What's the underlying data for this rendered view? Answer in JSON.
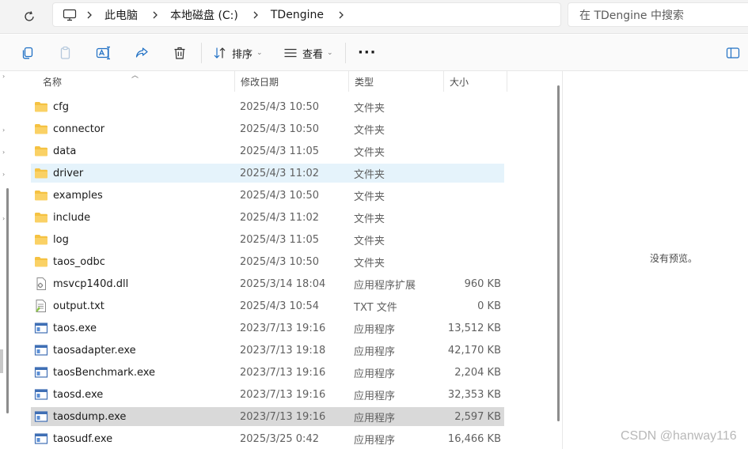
{
  "address_bar": {
    "breadcrumbs": [
      "此电脑",
      "本地磁盘 (C:)",
      "TDengine"
    ],
    "search_placeholder": "在 TDengine 中搜索"
  },
  "toolbar": {
    "sort_label": "排序",
    "view_label": "查看"
  },
  "columns": {
    "name": "名称",
    "date": "修改日期",
    "type": "类型",
    "size": "大小"
  },
  "files": [
    {
      "name": "cfg",
      "date": "2025/4/3 10:50",
      "type": "文件夹",
      "size": "",
      "icon": "folder-icon"
    },
    {
      "name": "connector",
      "date": "2025/4/3 10:50",
      "type": "文件夹",
      "size": "",
      "icon": "folder-icon"
    },
    {
      "name": "data",
      "date": "2025/4/3 11:05",
      "type": "文件夹",
      "size": "",
      "icon": "folder-icon"
    },
    {
      "name": "driver",
      "date": "2025/4/3 11:02",
      "type": "文件夹",
      "size": "",
      "icon": "folder-icon"
    },
    {
      "name": "examples",
      "date": "2025/4/3 10:50",
      "type": "文件夹",
      "size": "",
      "icon": "folder-icon"
    },
    {
      "name": "include",
      "date": "2025/4/3 11:02",
      "type": "文件夹",
      "size": "",
      "icon": "folder-icon"
    },
    {
      "name": "log",
      "date": "2025/4/3 11:05",
      "type": "文件夹",
      "size": "",
      "icon": "folder-icon"
    },
    {
      "name": "taos_odbc",
      "date": "2025/4/3 10:50",
      "type": "文件夹",
      "size": "",
      "icon": "folder-icon"
    },
    {
      "name": "msvcp140d.dll",
      "date": "2025/3/14 18:04",
      "type": "应用程序扩展",
      "size": "960 KB",
      "icon": "dll-file-icon"
    },
    {
      "name": "output.txt",
      "date": "2025/4/3 10:54",
      "type": "TXT 文件",
      "size": "0 KB",
      "icon": "text-file-icon"
    },
    {
      "name": "taos.exe",
      "date": "2023/7/13 19:16",
      "type": "应用程序",
      "size": "13,512 KB",
      "icon": "exe-file-icon"
    },
    {
      "name": "taosadapter.exe",
      "date": "2023/7/13 19:18",
      "type": "应用程序",
      "size": "42,170 KB",
      "icon": "exe-file-icon"
    },
    {
      "name": "taosBenchmark.exe",
      "date": "2023/7/13 19:16",
      "type": "应用程序",
      "size": "2,204 KB",
      "icon": "exe-file-icon"
    },
    {
      "name": "taosd.exe",
      "date": "2023/7/13 19:16",
      "type": "应用程序",
      "size": "32,353 KB",
      "icon": "exe-file-icon"
    },
    {
      "name": "taosdump.exe",
      "date": "2023/7/13 19:16",
      "type": "应用程序",
      "size": "2,597 KB",
      "icon": "exe-file-icon"
    },
    {
      "name": "taosudf.exe",
      "date": "2025/3/25 0:42",
      "type": "应用程序",
      "size": "16,466 KB",
      "icon": "exe-file-icon"
    }
  ],
  "preview": {
    "empty_text": "没有预览。"
  },
  "watermark": "CSDN @hanway116",
  "colors": {
    "folder": "#f7c948",
    "hover_row": "#e5f3fb",
    "selected_row": "#d9d9d9"
  }
}
